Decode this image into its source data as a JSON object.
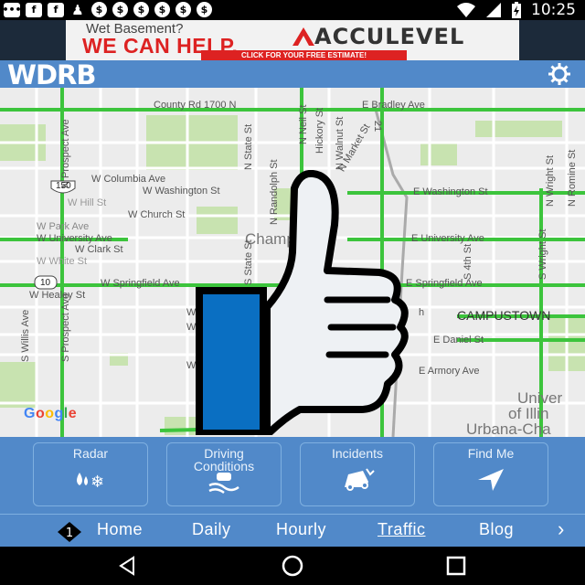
{
  "status_bar": {
    "time": "10:25",
    "notification_icons": [
      "message-icon",
      "facebook-icon",
      "facebook-icon",
      "person-icon",
      "dollar-icon",
      "dollar-icon",
      "dollar-icon",
      "dollar-icon",
      "dollar-icon",
      "dollar-icon"
    ],
    "notification_glyphs": [
      "•••",
      "f",
      "f",
      "♟",
      "$",
      "$",
      "$",
      "$",
      "$",
      "$"
    ]
  },
  "ad": {
    "line1": "Wet Basement?",
    "line2": "WE CAN HELP.",
    "brand": "ACCULEVEL",
    "cta": "CLICK FOR YOUR FREE ESTIMATE!"
  },
  "app": {
    "logo": "WDRB",
    "settings_icon": "gear-icon"
  },
  "map": {
    "labels": {
      "county_rd": "County Rd 1700 N",
      "e_bradley": "E Bradley Ave",
      "n_prospect": "N Prospect Ave",
      "n_neil": "N Neil St",
      "hickory": "Hickory St",
      "n_state": "N State St",
      "n_walnut": "N Walnut St",
      "n_market": "N Market St",
      "rt21": "21",
      "w_columbia": "W Columbia Ave",
      "w_washington": "W Washington St",
      "e_washington": "E Washington St",
      "rt150": "150",
      "w_hill": "W Hill St",
      "n_randolph": "N Randolph St",
      "w_church": "W Church St",
      "w_park": "W Park Ave",
      "w_university": "W University Ave",
      "e_university": "E University Ave",
      "champaign": "Champaign",
      "w_clark": "W Clark St",
      "w_white": "W White St",
      "rt10": "10",
      "w_springfield": "W Springfield Ave",
      "e_springfield": "E Springfield Ave",
      "w_healey": "W Healey St",
      "s_state": "S State St",
      "s_4th": "S 4th St",
      "s_wright": "S Wright St",
      "n_wright": "N Wright St",
      "n_romine": "N Romine St",
      "campustown": "CAMPUSTOWN",
      "s_willis": "S Willis Ave",
      "s_prospect": "S Prospect Ave",
      "e_daniel": "E Daniel St",
      "e_armory": "E Armory Ave",
      "univ1": "Univer",
      "univ2": "of Illin",
      "univ3": "Urbana-Cha",
      "w_g": "W G",
      "w_j": "W J",
      "w_m": "W",
      "h_partial": "h",
      "google": "Google"
    }
  },
  "tiles": [
    {
      "label": "Radar",
      "icon": "precipitation-icon"
    },
    {
      "label": "Driving\nConditions",
      "icon": "slippery-road-icon"
    },
    {
      "label": "Incidents",
      "icon": "crash-icon"
    },
    {
      "label": "Find Me",
      "icon": "location-arrow-icon"
    }
  ],
  "nav": {
    "badge": "1",
    "items": [
      "Home",
      "Daily",
      "Hourly",
      "Traffic",
      "Blog"
    ],
    "active": "Traffic",
    "more": "›"
  },
  "colors": {
    "header_blue": "#5189c9",
    "traffic_green": "#3cc43c",
    "thumb_blue": "#0a6fc2",
    "ad_red": "#dd2222"
  }
}
